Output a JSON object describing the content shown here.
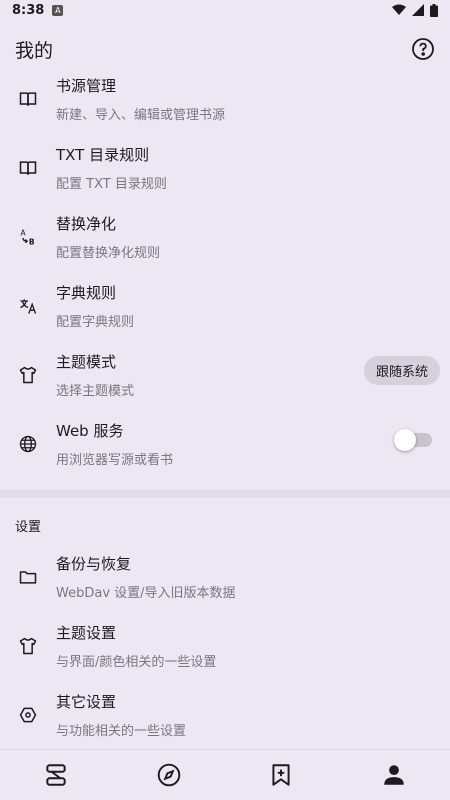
{
  "status_bar": {
    "time": "8:38",
    "notification_icon": "A"
  },
  "header": {
    "title": "我的",
    "help_icon": "help-circle-icon"
  },
  "items": [
    {
      "title": "书源管理",
      "subtitle": "新建、导入、编辑或管理书源",
      "icon": "book-open-icon"
    },
    {
      "title": "TXT 目录规则",
      "subtitle": "配置 TXT 目录规则",
      "icon": "book-open-icon"
    },
    {
      "title": "替换净化",
      "subtitle": "配置替换净化规则",
      "icon": "replace-icon"
    },
    {
      "title": "字典规则",
      "subtitle": "配置字典规则",
      "icon": "translate-icon"
    },
    {
      "title": "主题模式",
      "subtitle": "选择主题模式",
      "icon": "shirt-icon",
      "chip": "跟随系统"
    },
    {
      "title": "Web 服务",
      "subtitle": "用浏览器写源或看书",
      "icon": "globe-icon",
      "toggle_on": false
    }
  ],
  "section_label": "设置",
  "settings_items": [
    {
      "title": "备份与恢复",
      "subtitle": "WebDav 设置/导入旧版本数据",
      "icon": "folder-icon"
    },
    {
      "title": "主题设置",
      "subtitle": "与界面/颜色相关的一些设置",
      "icon": "shirt-icon"
    },
    {
      "title": "其它设置",
      "subtitle": "与功能相关的一些设置",
      "icon": "settings-hex-icon"
    }
  ],
  "bottom_nav": [
    {
      "name": "bookshelf-nav-icon",
      "active": false
    },
    {
      "name": "explore-nav-icon",
      "active": false
    },
    {
      "name": "rss-nav-icon",
      "active": false
    },
    {
      "name": "my-nav-icon",
      "active": true
    }
  ]
}
